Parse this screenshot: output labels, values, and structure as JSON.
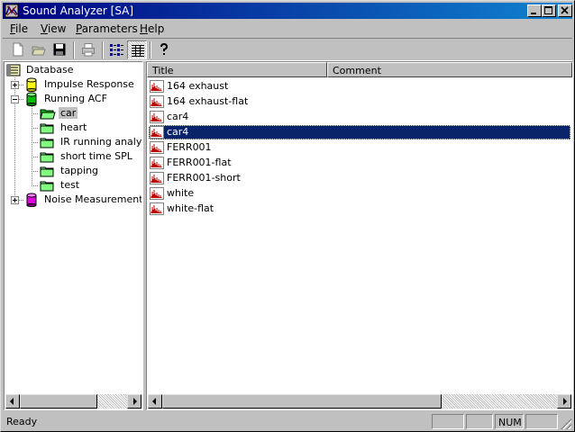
{
  "window": {
    "title": "Sound Analyzer [SA]"
  },
  "menu": [
    {
      "label": "File",
      "mnemonic": "F",
      "rest": "ile"
    },
    {
      "label": "View",
      "mnemonic": "V",
      "rest": "iew"
    },
    {
      "label": "Parameters",
      "mnemonic": "P",
      "rest": "arameters"
    },
    {
      "label": "Help",
      "mnemonic": "H",
      "rest": "elp"
    }
  ],
  "toolbar": {
    "buttons": [
      "new-icon",
      "open-icon",
      "save-icon",
      "print-icon",
      "list-view-icon",
      "details-view-icon",
      "help-icon"
    ],
    "pressed": "details-view-icon"
  },
  "tree": {
    "root": "Database",
    "nodes": [
      {
        "label": "Impulse Response",
        "color": "#ffff00",
        "expanded": false
      },
      {
        "label": "Running ACF",
        "color": "#00c000",
        "expanded": true
      },
      {
        "label": "Noise Measurement",
        "color": "#c000c0",
        "expanded": false
      }
    ],
    "children": [
      "car",
      "heart",
      "IR running analysi",
      "short time SPL",
      "tapping",
      "test"
    ],
    "selected_child": "car"
  },
  "list": {
    "columns": [
      "Title",
      "Comment"
    ],
    "rows": [
      "164 exhaust",
      "164 exhaust-flat",
      "car4",
      "car4",
      "FERR001",
      "FERR001-flat",
      "FERR001-short",
      "white",
      "white-flat"
    ],
    "selected_index": 3
  },
  "status": {
    "text": "Ready",
    "num": "NUM"
  },
  "colors": {
    "title_bar_start": "#000080",
    "title_bar_end": "#1084d0",
    "selection": "#0a246a",
    "face": "#c0c0c0"
  }
}
